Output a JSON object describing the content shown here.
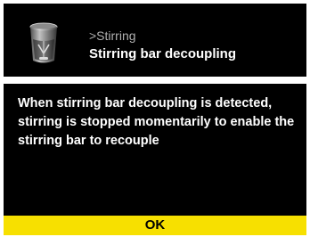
{
  "header": {
    "breadcrumb": ">Stirring",
    "title": "Stirring bar decoupling",
    "icon": "beaker-icon"
  },
  "message": {
    "text": "When stirring bar decoupling is detected, stirring is stopped momentarily to enable the stirring bar to recouple"
  },
  "footer": {
    "ok_label": "OK"
  },
  "colors": {
    "background": "#000000",
    "text": "#ffffff",
    "breadcrumb_text": "#b0b0b0",
    "ok_bar": "#f7e000",
    "ok_text": "#000000"
  }
}
